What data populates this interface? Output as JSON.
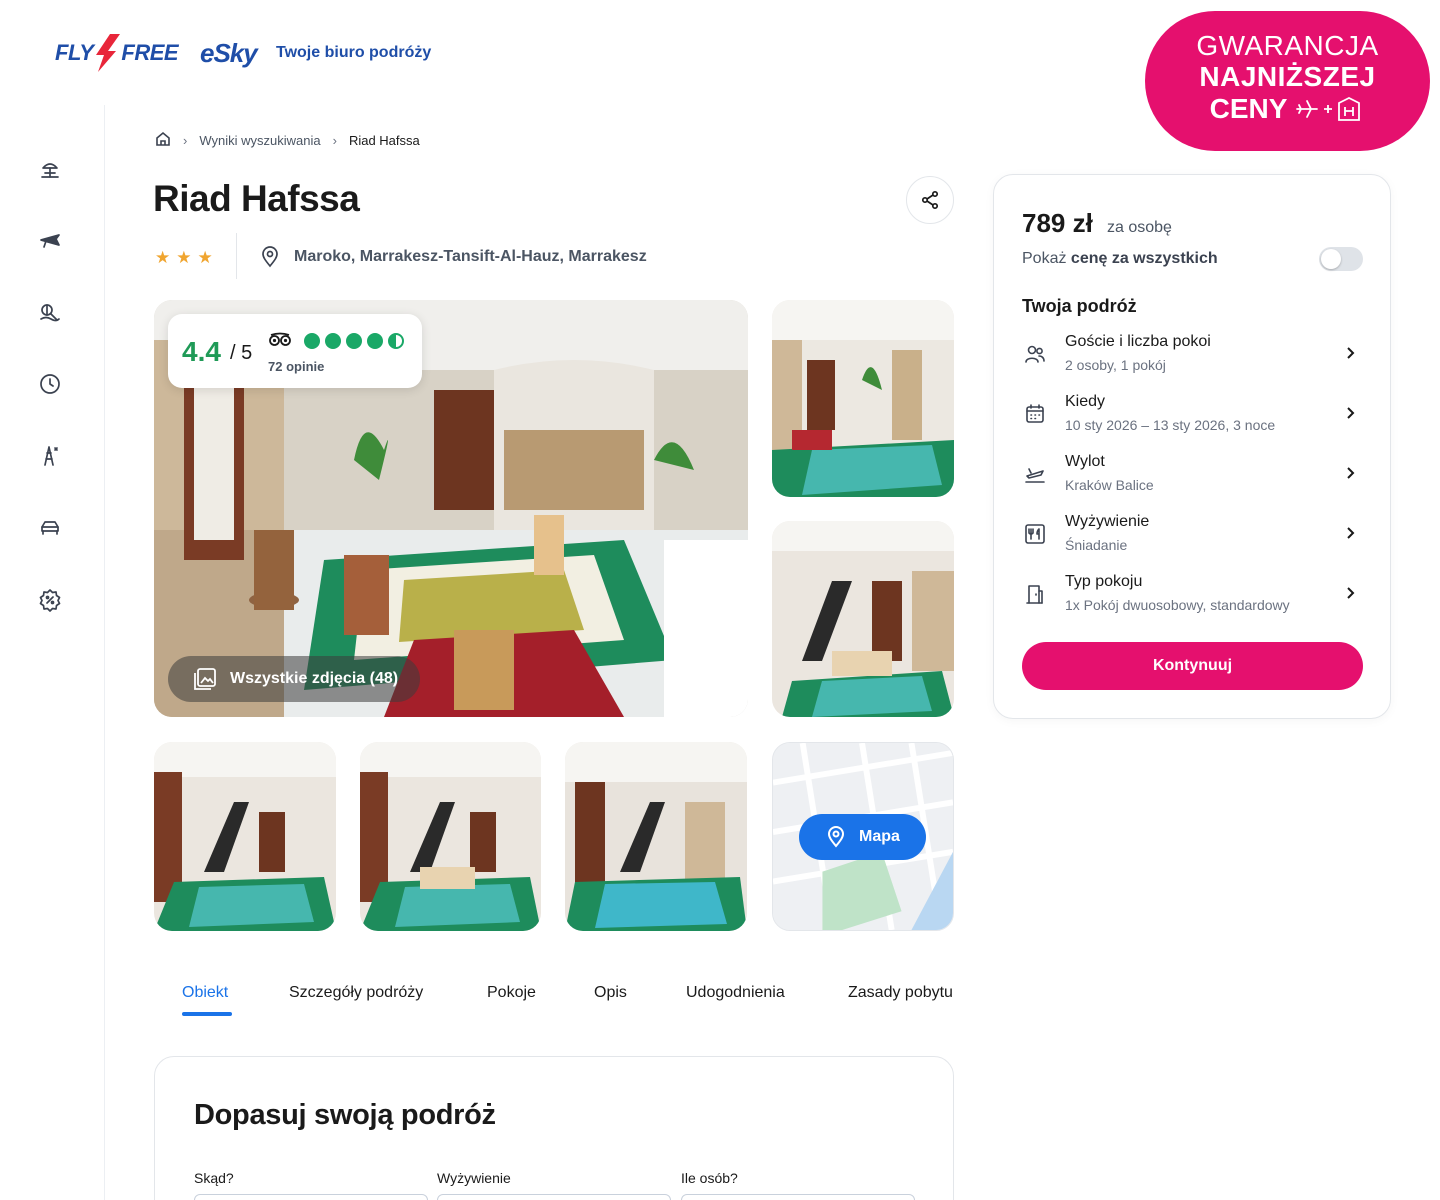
{
  "header": {
    "logo_flyfree": "FLY FREE",
    "logo_flyfree_left": "FLY",
    "logo_flyfree_right": "FREE",
    "logo_esky": "eSky",
    "tagline": "Twoje biuro podróży",
    "guarantee": {
      "line1": "GWARANCJA",
      "line2": "NAJNIŻSZEJ",
      "line3": "CENY"
    }
  },
  "sidebar": {
    "items": [
      {
        "icon": "beach-umbrella-icon"
      },
      {
        "icon": "plane-icon"
      },
      {
        "icon": "island-icon"
      },
      {
        "icon": "clock-icon"
      },
      {
        "icon": "eiffel-tower-icon"
      },
      {
        "icon": "car-icon"
      },
      {
        "icon": "discount-icon"
      }
    ]
  },
  "breadcrumb": {
    "items": [
      "Wyniki wyszukiwania",
      "Riad Hafssa"
    ]
  },
  "hotel": {
    "name": "Riad Hafssa",
    "stars": 3,
    "location": "Maroko, Marrakesz-Tansift-Al-Hauz, Marrakesz"
  },
  "rating": {
    "score": "4.4",
    "out_of": "/ 5",
    "tripadvisor_circles": 4.5,
    "reviews": "72 opinie"
  },
  "gallery": {
    "all_photos_label": "Wszystkie zdjęcia (48)",
    "map_label": "Mapa"
  },
  "tabs": [
    "Obiekt",
    "Szczegóły podróży",
    "Pokoje",
    "Opis",
    "Udogodnienia",
    "Zasady pobytu"
  ],
  "adjust": {
    "title": "Dopasuj swoją podróż",
    "fields": [
      "Skąd?",
      "Wyżywienie",
      "Ile osób?"
    ]
  },
  "booking": {
    "price": "789 zł",
    "per_person": "za osobę",
    "show_total_prefix": "Pokaż",
    "show_total_bold": "cenę za wszystkich",
    "toggle_on": false,
    "trip_title": "Twoja podróż",
    "options": [
      {
        "label": "Goście i liczba pokoi",
        "value": "2 osoby, 1 pokój",
        "icon": "guests-icon"
      },
      {
        "label": "Kiedy",
        "value": "10 sty 2026 – 13 sty 2026, 3 noce",
        "icon": "calendar-icon"
      },
      {
        "label": "Wylot",
        "value": "Kraków Balice",
        "icon": "plane-takeoff-icon"
      },
      {
        "label": "Wyżywienie",
        "value": "Śniadanie",
        "icon": "meal-icon"
      },
      {
        "label": "Typ pokoju",
        "value": "1x Pokój dwuosobowy, standardowy",
        "icon": "door-icon"
      }
    ],
    "continue_label": "Kontynuuj"
  },
  "colors": {
    "brand_pink": "#e5106e",
    "brand_blue": "#1f4ea8",
    "accent_blue": "#1a73e8",
    "rating_green": "#1f9a57"
  }
}
